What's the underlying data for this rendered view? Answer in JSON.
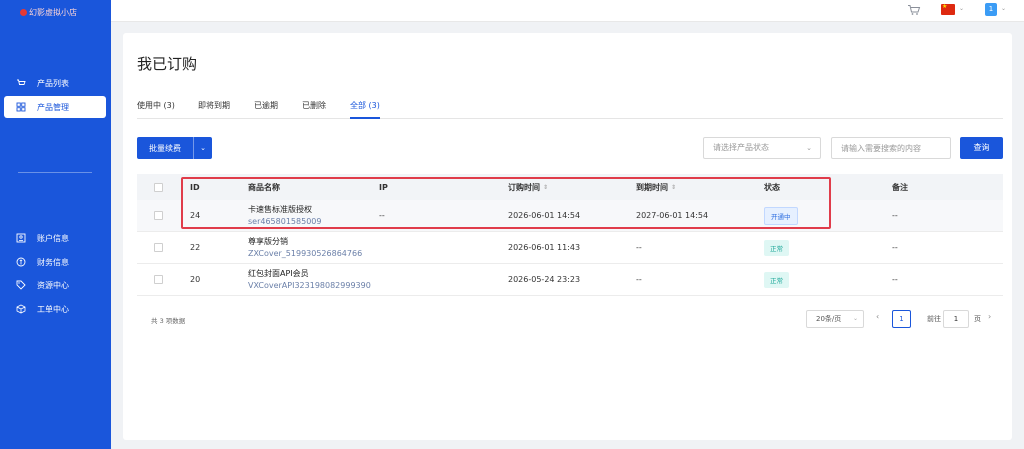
{
  "logo": {
    "text": "幻影虚拟小店"
  },
  "sidebar": {
    "items": [
      {
        "label": "产品列表",
        "icon": "cart-icon"
      },
      {
        "label": "产品管理",
        "icon": "grid-icon"
      },
      {
        "label": "账户信息",
        "icon": "id-card-icon"
      },
      {
        "label": "财务信息",
        "icon": "coin-icon"
      },
      {
        "label": "资源中心",
        "icon": "tag-icon"
      },
      {
        "label": "工单中心",
        "icon": "box-icon"
      }
    ]
  },
  "topbar": {
    "user_number": "1"
  },
  "page": {
    "title": "我已订购"
  },
  "tabs": [
    {
      "label": "使用中 (3)"
    },
    {
      "label": "即将到期"
    },
    {
      "label": "已逾期"
    },
    {
      "label": "已删除"
    },
    {
      "label": "全部 (3)",
      "active": true
    }
  ],
  "toolbar": {
    "batch_label": "批量续费",
    "status_placeholder": "请选择产品状态",
    "search_placeholder": "请输入需要搜索的内容",
    "query_label": "查询"
  },
  "table": {
    "headers": {
      "id": "ID",
      "name": "商品名称",
      "ip": "IP",
      "order_time": "订购时间",
      "expire_time": "到期时间",
      "status": "状态",
      "remark": "备注"
    },
    "rows": [
      {
        "id": "24",
        "name": "卡速售标准版授权",
        "code": "ser465801585009",
        "ip": "--",
        "order_time": "2026-06-01 14:54",
        "expire_time": "2027-06-01 14:54",
        "status": "开通中",
        "remark": "--"
      },
      {
        "id": "22",
        "name": "尊享版分销",
        "code": "ZXCover_519930526864766",
        "ip": "",
        "order_time": "2026-06-01 11:43",
        "expire_time": "--",
        "status": "正常",
        "remark": "--"
      },
      {
        "id": "20",
        "name": "红包封面API会员",
        "code": "VXCoverAPI323198082999390",
        "ip": "",
        "order_time": "2026-05-24 23:23",
        "expire_time": "--",
        "status": "正常",
        "remark": "--"
      }
    ]
  },
  "pagination": {
    "total_text": "共 3 项数据",
    "page_size": "20条/页",
    "current_page": "1",
    "goto_label": "前往",
    "goto_value": "1",
    "page_suffix": "页"
  },
  "colors": {
    "primary": "#1a56db",
    "highlight_border": "#e03c4a"
  }
}
